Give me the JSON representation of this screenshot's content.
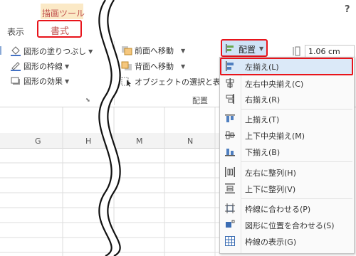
{
  "context_tab_group": "描画ツール",
  "tabs": {
    "view": "表示",
    "format": "書式"
  },
  "help_label": "?",
  "shape_styles": {
    "fill": "図形の塗りつぶし",
    "outline": "図形の枠線",
    "effects": "図形の効果"
  },
  "arrange": {
    "bring_forward": "前面へ移動",
    "send_backward": "背面へ移動",
    "selection_pane": "オブジェクトの選択と表示",
    "group_label": "配置",
    "align_button": "配置"
  },
  "size": {
    "width_value": "1.06 cm"
  },
  "columns": [
    "G",
    "H",
    "M",
    "N"
  ],
  "align_menu": {
    "items": [
      {
        "label": "左揃え(L)",
        "icon": "align-left-icon"
      },
      {
        "label": "左右中央揃え(C)",
        "icon": "align-center-icon"
      },
      {
        "label": "右揃え(R)",
        "icon": "align-right-icon"
      },
      {
        "label": "上揃え(T)",
        "icon": "align-top-icon"
      },
      {
        "label": "上下中央揃え(M)",
        "icon": "align-middle-icon"
      },
      {
        "label": "下揃え(B)",
        "icon": "align-bottom-icon"
      },
      {
        "label": "左右に整列(H)",
        "icon": "distribute-horizontal-icon"
      },
      {
        "label": "上下に整列(V)",
        "icon": "distribute-vertical-icon"
      },
      {
        "label": "枠線に合わせる(P)",
        "icon": "snap-to-grid-icon"
      },
      {
        "label": "図形に位置を合わせる(S)",
        "icon": "snap-to-shape-icon"
      },
      {
        "label": "枠線の表示(G)",
        "icon": "view-gridlines-icon"
      }
    ]
  },
  "colors": {
    "highlight_red": "#e8141b",
    "context_tab_orange": "#c0504d",
    "context_tab_bg": "#fbe9c6",
    "menu_selected_bg": "#dbe9f8"
  }
}
